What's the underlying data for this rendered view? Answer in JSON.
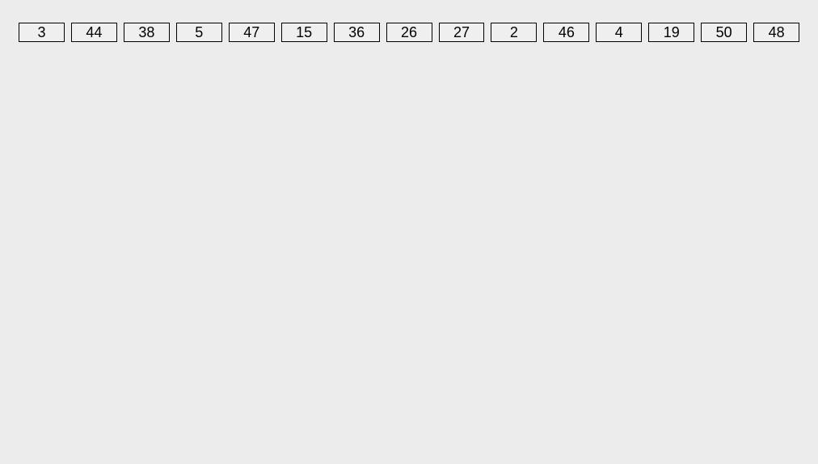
{
  "buttons": [
    {
      "label": "3"
    },
    {
      "label": "44"
    },
    {
      "label": "38"
    },
    {
      "label": "5"
    },
    {
      "label": "47"
    },
    {
      "label": "15"
    },
    {
      "label": "36"
    },
    {
      "label": "26"
    },
    {
      "label": "27"
    },
    {
      "label": "2"
    },
    {
      "label": "46"
    },
    {
      "label": "4"
    },
    {
      "label": "19"
    },
    {
      "label": "50"
    },
    {
      "label": "48"
    }
  ]
}
